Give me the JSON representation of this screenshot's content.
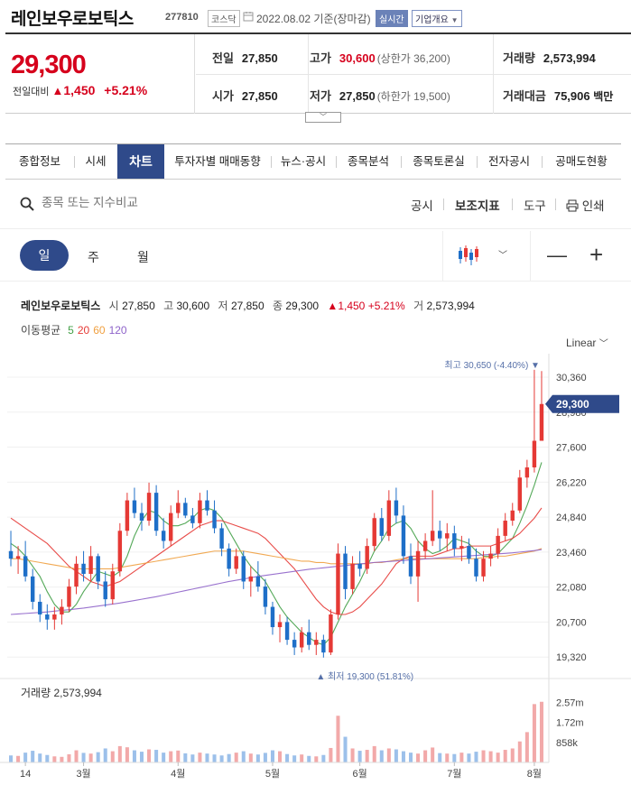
{
  "header": {
    "name": "레인보우로보틱스",
    "code": "277810",
    "market": "코스닥",
    "date": "2022.08.02",
    "basis": "기준(장마감)",
    "live_badge": "실시간",
    "info_button": "기업개요"
  },
  "quote": {
    "price": "29,300",
    "change_label": "전일대비",
    "change": "1,450",
    "change_pct": "+5.21%",
    "prev_close_label": "전일",
    "prev_close": "27,850",
    "high_label": "고가",
    "high": "30,600",
    "upper_limit": "(상한가 36,200)",
    "volume_label": "거래량",
    "volume": "2,573,994",
    "open_label": "시가",
    "open": "27,850",
    "low_label": "저가",
    "low": "27,850",
    "lower_limit": "(하한가 19,500)",
    "amount_label": "거래대금",
    "amount": "75,906",
    "amount_unit": "백만"
  },
  "tabs": [
    "종합정보",
    "시세",
    "차트",
    "투자자별 매매동향",
    "뉴스·공시",
    "종목분석",
    "종목토론실",
    "전자공시",
    "공매도현황"
  ],
  "active_tab": "차트",
  "toolbar": {
    "search_placeholder": "종목 또는 지수비교",
    "disclosure": "공시",
    "indicator": "보조지표",
    "tools": "도구",
    "print": "인쇄"
  },
  "periods": {
    "day": "일",
    "week": "주",
    "month": "월"
  },
  "ohlc_line": {
    "name": "레인보우로보틱스",
    "open_label": "시",
    "open": "27,850",
    "high_label": "고",
    "high": "30,600",
    "low_label": "저",
    "low": "27,850",
    "close_label": "종",
    "close": "29,300",
    "change": "1,450",
    "change_pct": "+5.21%",
    "volume_label": "거",
    "volume": "2,573,994"
  },
  "ma_legend": {
    "label": "이동평균",
    "items": [
      {
        "text": "5",
        "color": "#43a047"
      },
      {
        "text": "20",
        "color": "#e53935"
      },
      {
        "text": "60",
        "color": "#f0a040"
      },
      {
        "text": "120",
        "color": "#8e63c9"
      }
    ]
  },
  "scale_mode": "Linear",
  "icons": [
    "search-icon",
    "print-icon",
    "candle-chart-icon",
    "chevron-down-icon",
    "zoom-out-icon",
    "zoom-in-icon"
  ],
  "colors": {
    "up": "#e53935",
    "down": "#1e6fc8",
    "accent": "#2f4a8a"
  },
  "chart_data": {
    "type": "candlestick",
    "ylim": [
      18900,
      31000
    ],
    "y_ticks": [
      "30,360",
      "28,980",
      "27,600",
      "26,220",
      "24,840",
      "23,460",
      "22,080",
      "20,700",
      "19,320"
    ],
    "y_tick_values": [
      30360,
      28980,
      27600,
      26220,
      24840,
      23460,
      22080,
      20700,
      19320
    ],
    "x_labels": [
      "14",
      "3월",
      "4월",
      "5월",
      "6월",
      "7월",
      "8월"
    ],
    "x_label_index": [
      2,
      10,
      23,
      36,
      48,
      61,
      72
    ],
    "current_price_tag": "29,300",
    "current_price": 29300,
    "max_label": "최고 30,650 (-4.40%)",
    "max_value": 30650,
    "max_index": 73,
    "min_label": "최저 19,300 (51.81%)",
    "min_value": 19300,
    "min_index": 43,
    "candles": [
      {
        "o": 23500,
        "h": 24300,
        "l": 22900,
        "c": 23200
      },
      {
        "o": 23200,
        "h": 23700,
        "l": 22600,
        "c": 23300
      },
      {
        "o": 23300,
        "h": 23900,
        "l": 22300,
        "c": 22500
      },
      {
        "o": 22500,
        "h": 22800,
        "l": 21200,
        "c": 21500
      },
      {
        "o": 21500,
        "h": 21800,
        "l": 20700,
        "c": 21000
      },
      {
        "o": 21000,
        "h": 21400,
        "l": 20400,
        "c": 20800
      },
      {
        "o": 20800,
        "h": 21300,
        "l": 20400,
        "c": 21000
      },
      {
        "o": 21000,
        "h": 21600,
        "l": 20600,
        "c": 21300
      },
      {
        "o": 21300,
        "h": 22400,
        "l": 21100,
        "c": 22100
      },
      {
        "o": 22100,
        "h": 23300,
        "l": 21800,
        "c": 23000
      },
      {
        "o": 23000,
        "h": 23500,
        "l": 22300,
        "c": 22600
      },
      {
        "o": 22600,
        "h": 23700,
        "l": 22300,
        "c": 23300
      },
      {
        "o": 23300,
        "h": 23400,
        "l": 22000,
        "c": 22300
      },
      {
        "o": 22300,
        "h": 22700,
        "l": 21300,
        "c": 21600
      },
      {
        "o": 21600,
        "h": 23000,
        "l": 21400,
        "c": 22700
      },
      {
        "o": 22700,
        "h": 24600,
        "l": 22500,
        "c": 24300
      },
      {
        "o": 24300,
        "h": 25800,
        "l": 24100,
        "c": 25500
      },
      {
        "o": 25500,
        "h": 26000,
        "l": 24800,
        "c": 25000
      },
      {
        "o": 25000,
        "h": 25400,
        "l": 24300,
        "c": 24700
      },
      {
        "o": 24700,
        "h": 26200,
        "l": 24500,
        "c": 25800
      },
      {
        "o": 25800,
        "h": 26100,
        "l": 24100,
        "c": 24300
      },
      {
        "o": 24300,
        "h": 24800,
        "l": 23600,
        "c": 23900
      },
      {
        "o": 23900,
        "h": 25300,
        "l": 23700,
        "c": 25000
      },
      {
        "o": 25000,
        "h": 25900,
        "l": 24800,
        "c": 25400
      },
      {
        "o": 25400,
        "h": 25600,
        "l": 24800,
        "c": 24900
      },
      {
        "o": 24900,
        "h": 25200,
        "l": 24400,
        "c": 24600
      },
      {
        "o": 24600,
        "h": 25800,
        "l": 24400,
        "c": 25500
      },
      {
        "o": 25500,
        "h": 25900,
        "l": 24900,
        "c": 25100
      },
      {
        "o": 25100,
        "h": 25500,
        "l": 24200,
        "c": 24400
      },
      {
        "o": 24400,
        "h": 24600,
        "l": 23300,
        "c": 23600
      },
      {
        "o": 23600,
        "h": 23800,
        "l": 22500,
        "c": 22800
      },
      {
        "o": 22800,
        "h": 23600,
        "l": 22600,
        "c": 23300
      },
      {
        "o": 23300,
        "h": 23500,
        "l": 22000,
        "c": 22300
      },
      {
        "o": 22300,
        "h": 22900,
        "l": 21700,
        "c": 22500
      },
      {
        "o": 22500,
        "h": 23100,
        "l": 21900,
        "c": 22100
      },
      {
        "o": 22100,
        "h": 22400,
        "l": 21000,
        "c": 21300
      },
      {
        "o": 21300,
        "h": 21500,
        "l": 20200,
        "c": 20500
      },
      {
        "o": 20500,
        "h": 21000,
        "l": 19900,
        "c": 20700
      },
      {
        "o": 20700,
        "h": 20900,
        "l": 19800,
        "c": 20000
      },
      {
        "o": 20000,
        "h": 20300,
        "l": 19400,
        "c": 19700
      },
      {
        "o": 19700,
        "h": 20500,
        "l": 19500,
        "c": 20300
      },
      {
        "o": 20300,
        "h": 20800,
        "l": 19600,
        "c": 19800
      },
      {
        "o": 19800,
        "h": 20300,
        "l": 19400,
        "c": 20000
      },
      {
        "o": 20000,
        "h": 20200,
        "l": 19300,
        "c": 19500
      },
      {
        "o": 19500,
        "h": 21200,
        "l": 19400,
        "c": 21000
      },
      {
        "o": 21000,
        "h": 23800,
        "l": 20800,
        "c": 23400
      },
      {
        "o": 23400,
        "h": 23700,
        "l": 21600,
        "c": 22000
      },
      {
        "o": 22000,
        "h": 23300,
        "l": 21800,
        "c": 23000
      },
      {
        "o": 23000,
        "h": 23500,
        "l": 22500,
        "c": 22800
      },
      {
        "o": 22800,
        "h": 24000,
        "l": 22600,
        "c": 23700
      },
      {
        "o": 23700,
        "h": 25000,
        "l": 23500,
        "c": 24800
      },
      {
        "o": 24800,
        "h": 25200,
        "l": 23900,
        "c": 24100
      },
      {
        "o": 24100,
        "h": 25900,
        "l": 23900,
        "c": 25500
      },
      {
        "o": 25500,
        "h": 26000,
        "l": 24600,
        "c": 24900
      },
      {
        "o": 24900,
        "h": 25300,
        "l": 23000,
        "c": 23300
      },
      {
        "o": 23300,
        "h": 23800,
        "l": 22200,
        "c": 22500
      },
      {
        "o": 22500,
        "h": 23900,
        "l": 21500,
        "c": 23500
      },
      {
        "o": 23500,
        "h": 24200,
        "l": 23200,
        "c": 23900
      },
      {
        "o": 23900,
        "h": 25900,
        "l": 23700,
        "c": 24300
      },
      {
        "o": 24300,
        "h": 24700,
        "l": 23500,
        "c": 24000
      },
      {
        "o": 24000,
        "h": 24600,
        "l": 23500,
        "c": 24200
      },
      {
        "o": 24200,
        "h": 24500,
        "l": 23300,
        "c": 23600
      },
      {
        "o": 23600,
        "h": 24100,
        "l": 23100,
        "c": 23700
      },
      {
        "o": 23700,
        "h": 24000,
        "l": 23000,
        "c": 23200
      },
      {
        "o": 23200,
        "h": 23600,
        "l": 22300,
        "c": 22500
      },
      {
        "o": 22500,
        "h": 23500,
        "l": 22300,
        "c": 23200
      },
      {
        "o": 23200,
        "h": 23700,
        "l": 22900,
        "c": 23400
      },
      {
        "o": 23400,
        "h": 24400,
        "l": 23200,
        "c": 24100
      },
      {
        "o": 24100,
        "h": 25000,
        "l": 23900,
        "c": 24700
      },
      {
        "o": 24700,
        "h": 25400,
        "l": 24500,
        "c": 25100
      },
      {
        "o": 25100,
        "h": 26700,
        "l": 25000,
        "c": 26400
      },
      {
        "o": 26400,
        "h": 27100,
        "l": 26000,
        "c": 26800
      },
      {
        "o": 26800,
        "h": 30650,
        "l": 26600,
        "c": 27850
      },
      {
        "o": 27850,
        "h": 30600,
        "l": 27850,
        "c": 29300
      }
    ],
    "ma_series": [
      {
        "label": "5",
        "color": "#43a047",
        "values": [
          23800,
          23600,
          23300,
          22900,
          22500,
          21900,
          21400,
          21100,
          21100,
          21400,
          21900,
          22300,
          22700,
          22600,
          22500,
          22700,
          23300,
          24100,
          24700,
          25100,
          25000,
          24700,
          24500,
          24500,
          24600,
          24800,
          25100,
          25200,
          25100,
          24800,
          24300,
          23800,
          23300,
          22900,
          22600,
          22300,
          21800,
          21300,
          20900,
          20600,
          20300,
          20100,
          19900,
          19800,
          20100,
          20700,
          21300,
          21800,
          22300,
          22900,
          23500,
          23900,
          24400,
          24600,
          24700,
          24400,
          23900,
          23600,
          23400,
          23500,
          23700,
          24000,
          23900,
          23800,
          23500,
          23300,
          23300,
          23400,
          23700,
          24000,
          24600,
          25300,
          26100,
          27000
        ]
      },
      {
        "label": "20",
        "color": "#e53935",
        "values": [
          24800,
          24600,
          24400,
          24200,
          24000,
          23800,
          23500,
          23200,
          22900,
          22700,
          22500,
          22300,
          22200,
          22100,
          22200,
          22300,
          22500,
          22700,
          22900,
          23100,
          23300,
          23500,
          23700,
          23900,
          24100,
          24300,
          24500,
          24600,
          24700,
          24700,
          24600,
          24500,
          24400,
          24300,
          24200,
          24000,
          23700,
          23400,
          23100,
          22800,
          22400,
          22000,
          21600,
          21300,
          21100,
          21000,
          21000,
          21100,
          21300,
          21600,
          21900,
          22200,
          22600,
          23000,
          23200,
          23300,
          23300,
          23300,
          23300,
          23400,
          23500,
          23600,
          23600,
          23700,
          23700,
          23700,
          23700,
          23800,
          23900,
          24000,
          24200,
          24500,
          24800,
          25200
        ]
      },
      {
        "label": "60",
        "color": "#f0a040",
        "values": [
          23200,
          23200,
          23150,
          23100,
          23050,
          23000,
          22950,
          22900,
          22850,
          22800,
          22800,
          22800,
          22800,
          22800,
          22800,
          22850,
          22900,
          22950,
          23000,
          23050,
          23100,
          23150,
          23200,
          23250,
          23300,
          23350,
          23400,
          23450,
          23500,
          23500,
          23500,
          23500,
          23500,
          23450,
          23400,
          23350,
          23300,
          23250,
          23200,
          23150,
          23100,
          23100,
          23050,
          23050,
          23000,
          23000,
          23000,
          23000,
          23000,
          23000,
          23050,
          23050,
          23100,
          23150,
          23200,
          23200,
          23200,
          23200,
          23200,
          23200,
          23200,
          23200,
          23200,
          23200,
          23200,
          23250,
          23250,
          23300,
          23300,
          23350,
          23400,
          23450,
          23500,
          23600
        ]
      },
      {
        "label": "120",
        "color": "#8e63c9",
        "values": [
          21000,
          21020,
          21040,
          21060,
          21080,
          21100,
          21130,
          21160,
          21190,
          21220,
          21250,
          21290,
          21330,
          21370,
          21410,
          21450,
          21500,
          21550,
          21600,
          21650,
          21700,
          21760,
          21820,
          21880,
          21940,
          22000,
          22060,
          22120,
          22180,
          22240,
          22300,
          22350,
          22400,
          22450,
          22500,
          22540,
          22580,
          22620,
          22660,
          22700,
          22740,
          22780,
          22810,
          22840,
          22870,
          22900,
          22930,
          22960,
          22990,
          23020,
          23050,
          23070,
          23090,
          23110,
          23130,
          23150,
          23170,
          23190,
          23210,
          23230,
          23250,
          23270,
          23290,
          23310,
          23330,
          23350,
          23370,
          23390,
          23410,
          23430,
          23460,
          23490,
          23520,
          23560
        ]
      }
    ],
    "volume_label": "거래량",
    "volume_value": "2,573,994",
    "volume_ticks": [
      "2.57m",
      "1.72m",
      "858k"
    ],
    "volume_tick_values": [
      2570000,
      1720000,
      858000
    ],
    "volume_max": 2900000,
    "volumes": [
      300,
      280,
      420,
      500,
      380,
      320,
      260,
      240,
      350,
      520,
      410,
      380,
      440,
      600,
      480,
      700,
      650,
      520,
      460,
      560,
      540,
      420,
      480,
      510,
      390,
      340,
      420,
      380,
      340,
      300,
      360,
      420,
      480,
      380,
      340,
      410,
      520,
      480,
      360,
      300,
      340,
      280,
      260,
      320,
      620,
      2000,
      1100,
      600,
      500,
      540,
      700,
      520,
      600,
      560,
      480,
      420,
      380,
      520,
      640,
      400,
      380,
      360,
      420,
      380,
      460,
      520,
      480,
      420,
      540,
      600,
      900,
      1300,
      2500,
      2600
    ]
  }
}
